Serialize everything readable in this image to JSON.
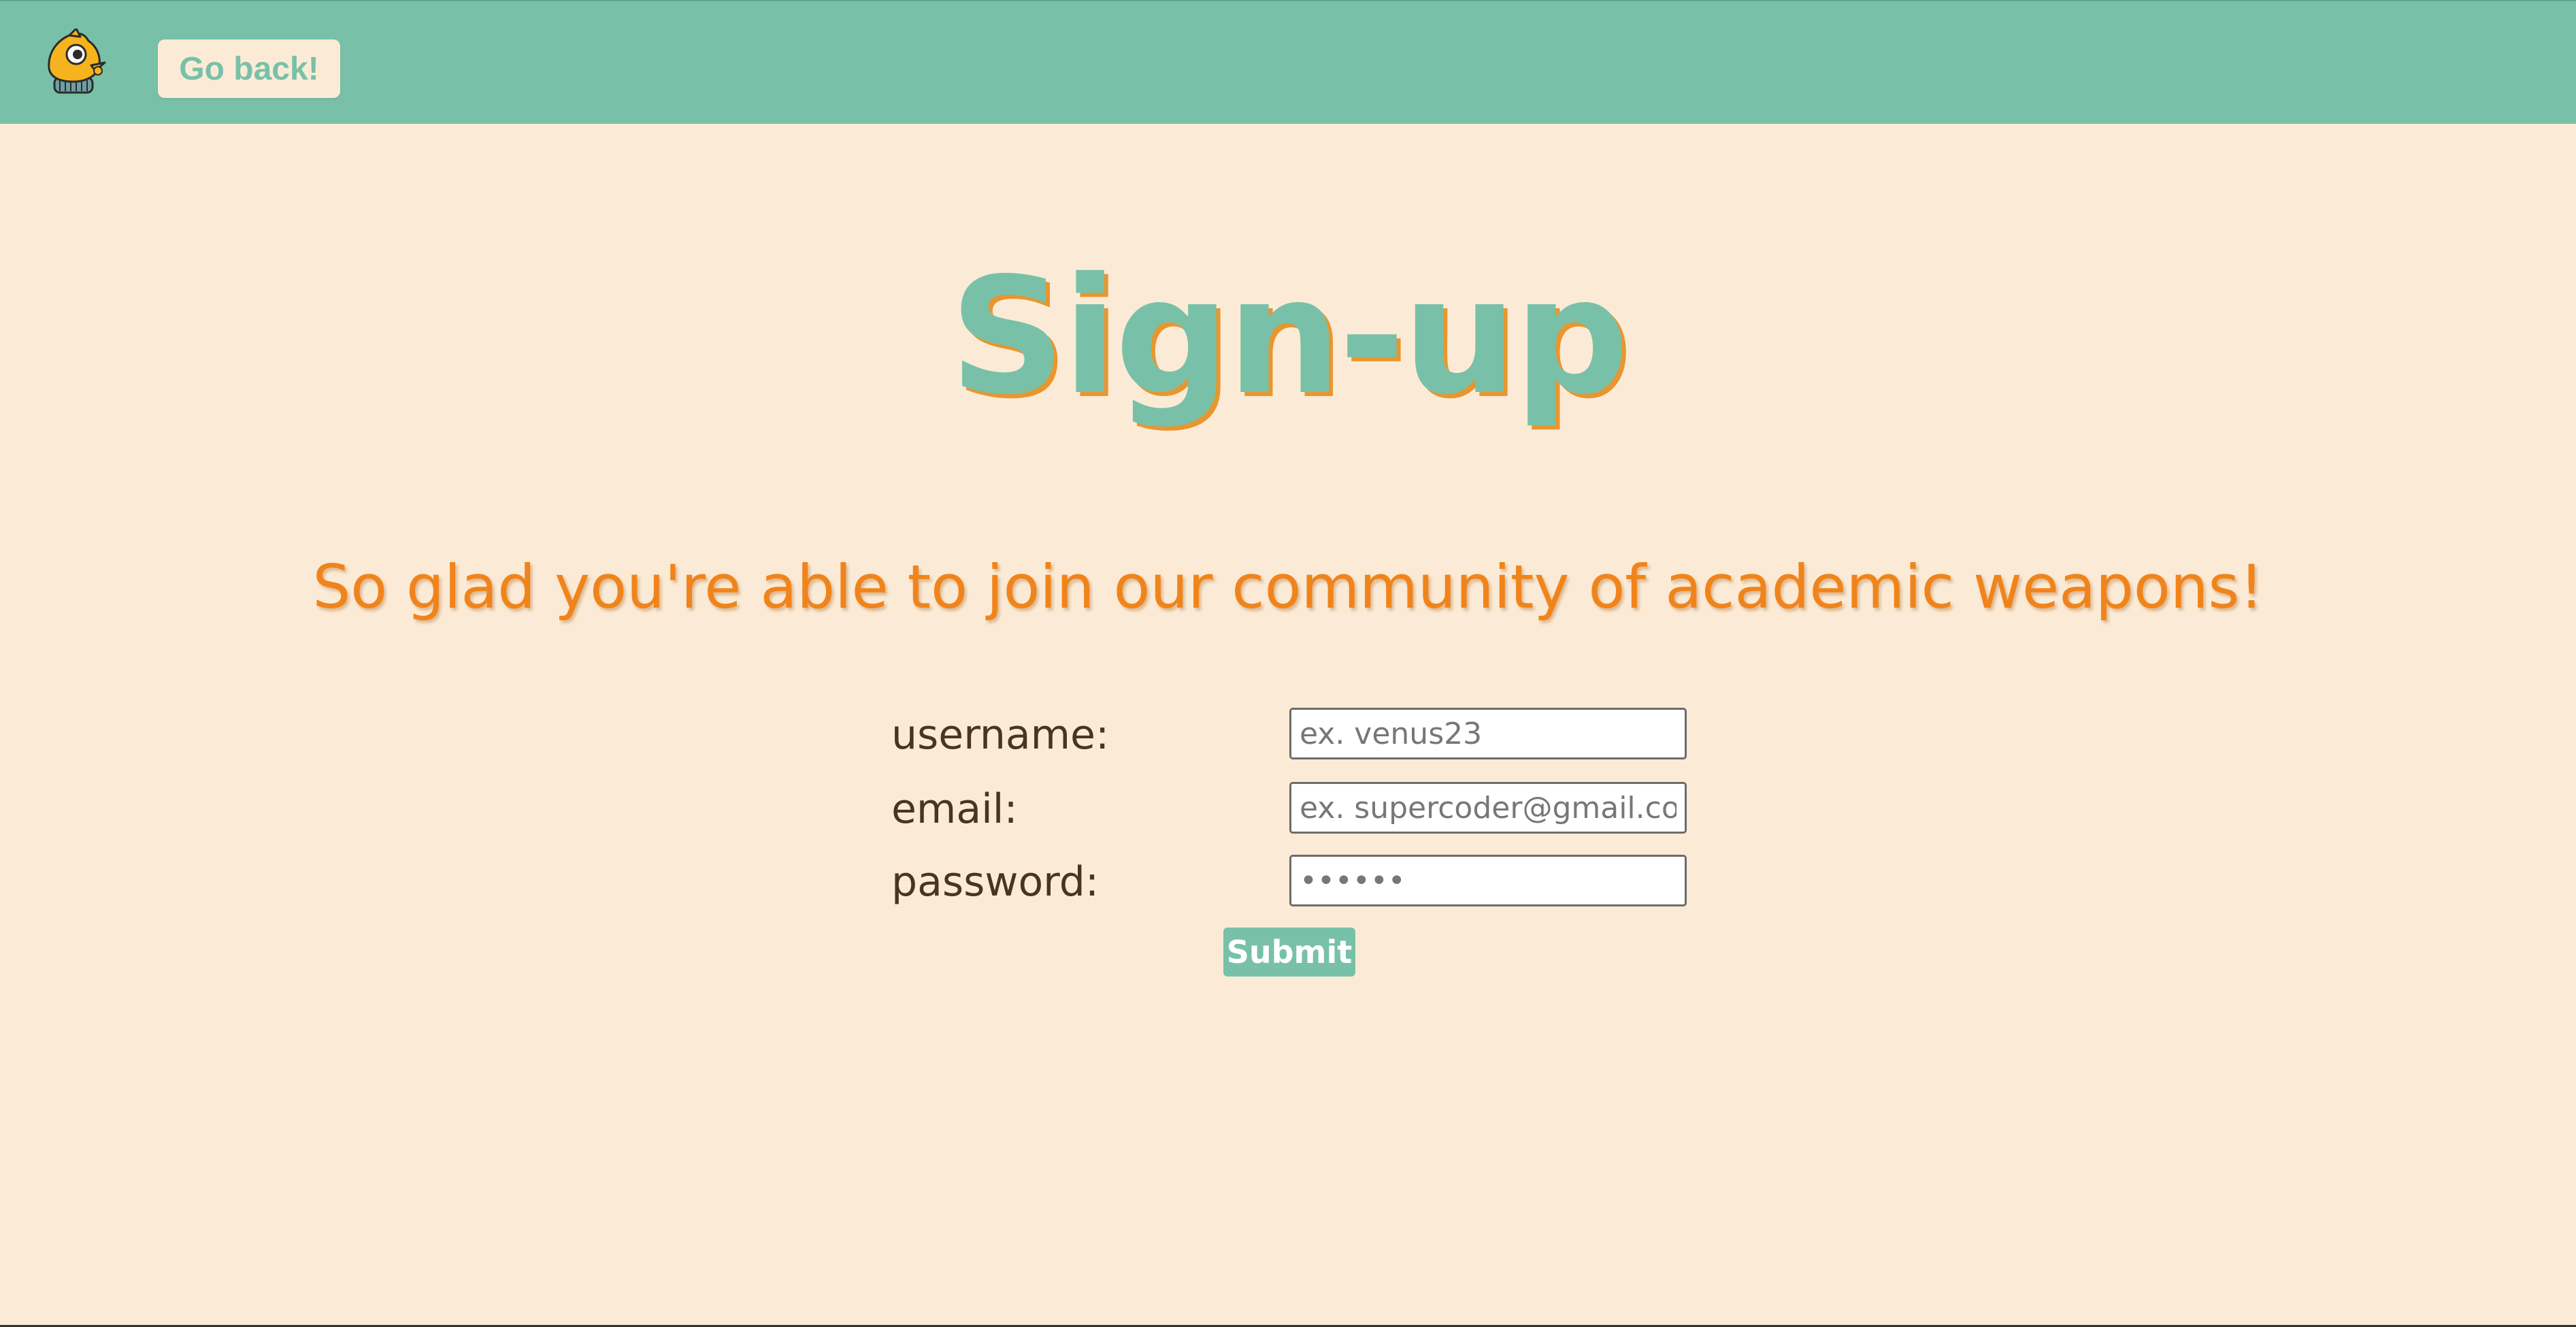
{
  "header": {
    "go_back_label": "Go back!",
    "logo_icon": "fish-mascot-logo",
    "background_color": "#78c1a8"
  },
  "main": {
    "title": "Sign-up",
    "subtitle": "So glad you're able to join our community of academic weapons!"
  },
  "form": {
    "username_label": "username:",
    "username_placeholder": "ex. venus23",
    "email_label": "email:",
    "email_placeholder": "ex. supercoder@gmail.com",
    "password_label": "password:",
    "password_placeholder": "••••••",
    "submit_label": "Submit"
  },
  "colors": {
    "page_background": "#fbebd6",
    "accent_green": "#78c1a8",
    "accent_orange": "#f0841b",
    "label_brown": "#4b3324"
  }
}
